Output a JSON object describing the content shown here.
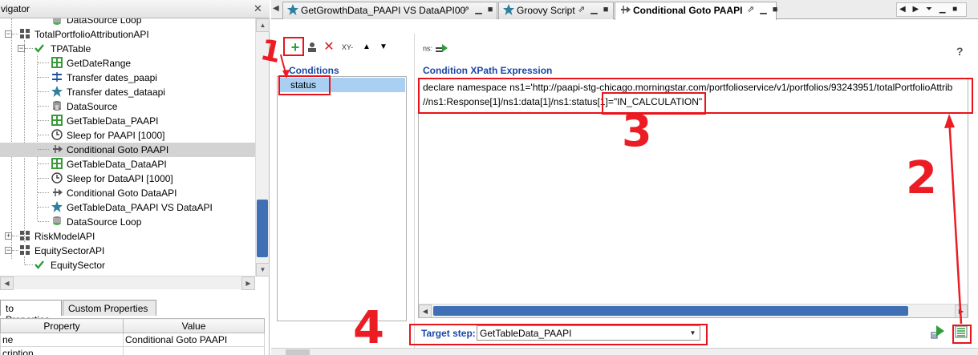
{
  "navigator": {
    "title": "vigator",
    "close_glyph": "✕",
    "tree": [
      {
        "label": "DataSource Loop",
        "icon": "datasource-loop-icon"
      },
      {
        "label": "TotalPortfolioAttributionAPI",
        "icon": "testsuite-grid-icon"
      },
      {
        "label": "TPATable",
        "icon": "check-icon"
      },
      {
        "label": "GetDateRange",
        "icon": "groovy-step-icon"
      },
      {
        "label": "Transfer dates_paapi",
        "icon": "property-transfer-icon"
      },
      {
        "label": "Transfer dates_dataapi",
        "icon": "star-icon"
      },
      {
        "label": "DataSource",
        "icon": "datasource-icon"
      },
      {
        "label": "GetTableData_PAAPI",
        "icon": "groovy-step-icon"
      },
      {
        "label": "Sleep for PAAPI [1000]",
        "icon": "clock-icon"
      },
      {
        "label": "Conditional Goto PAAPI",
        "icon": "conditional-goto-icon"
      },
      {
        "label": "GetTableData_DataAPI",
        "icon": "groovy-step-icon"
      },
      {
        "label": "Sleep for DataAPI [1000]",
        "icon": "clock-icon"
      },
      {
        "label": "Conditional Goto DataAPI",
        "icon": "conditional-goto-icon"
      },
      {
        "label": "GetTableData_PAAPI VS DataAPI",
        "icon": "star-icon"
      },
      {
        "label": "DataSource Loop",
        "icon": "datasource-loop-icon"
      },
      {
        "label": "RiskModelAPI",
        "icon": "testsuite-grid-icon"
      },
      {
        "label": "EquitySectorAPI",
        "icon": "testsuite-grid-icon"
      },
      {
        "label": "EquitySector",
        "icon": "check-icon"
      }
    ],
    "selected_index": 9
  },
  "properties": {
    "tabs": [
      "to Properties",
      "Custom Properties"
    ],
    "columns": [
      "Property",
      "Value"
    ],
    "rows": [
      {
        "name": "ne",
        "value": "Conditional Goto PAAPI"
      },
      {
        "name": "cription",
        "value": ""
      }
    ]
  },
  "editor_tabs": [
    {
      "label": "GetGrowthData_PAAPI VS DataAPI00",
      "active": false
    },
    {
      "label": "Groovy Script",
      "active": false
    },
    {
      "label": "Conditional Goto PAAPI",
      "active": true
    }
  ],
  "tab_controls": "⇗ ▁ ■",
  "tab_nav": "◀ ▶ ⏷ ▁ ■",
  "conditions": {
    "toolbar": {
      "add": "+",
      "delete": "✕",
      "rename": "XY-",
      "up": "▲",
      "down": "▼"
    },
    "label": "Conditions",
    "items": [
      "status"
    ]
  },
  "xpath": {
    "toolbar_text": "ns:",
    "label": "Condition XPath Expression",
    "help": "?",
    "line1": "declare namespace ns1='http://paapi-stg-chicago.morningstar.com/portfolioservice/v1/portfolios/93243951/totalPortfolioAttrib",
    "line2": "//ns1:Response[1]/ns1:data[1]/ns1:status[1]=\"IN_CALCULATION\""
  },
  "target": {
    "label": "Target step:",
    "value": "GetTableData_PAAPI"
  },
  "annotations": [
    "1",
    "2",
    "3",
    "4"
  ],
  "colors": {
    "annotation": "#e8141b",
    "label_blue": "#1a47a6",
    "selection": "#a9cff3",
    "scroll_thumb": "#3f6fb5"
  }
}
